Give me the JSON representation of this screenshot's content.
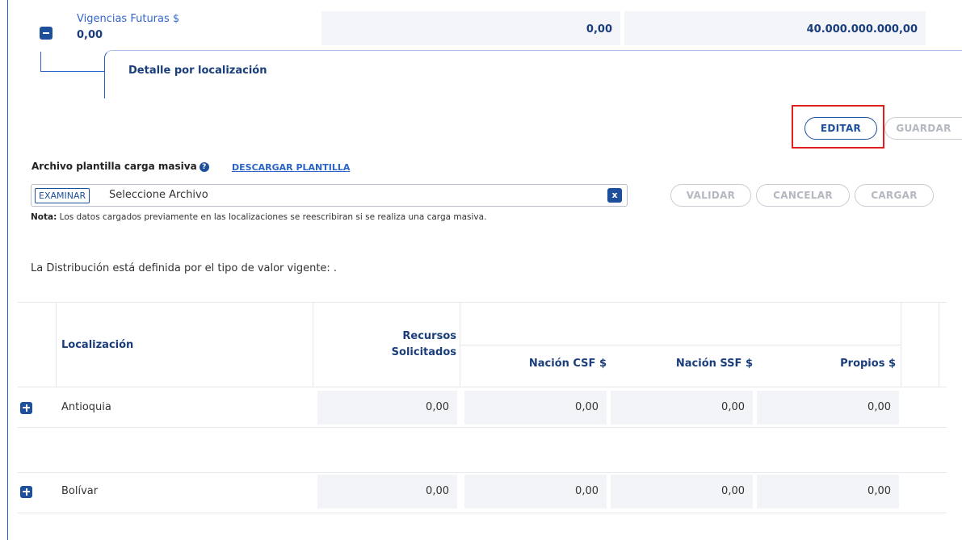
{
  "vigencias": {
    "label": "Vigencias Futuras $",
    "value": "0,00",
    "col1": "0,00",
    "col2": "40.000.000.000,00"
  },
  "detalle": {
    "title": "Detalle por localización"
  },
  "actions": {
    "editar": "EDITAR",
    "guardar": "GUARDAR"
  },
  "upload": {
    "label": "Archivo plantilla carga masiva",
    "help_icon": "?",
    "download_link": "DESCARGAR PLANTILLA",
    "examinar": "EXAMINAR",
    "placeholder": "Seleccione Archivo",
    "clear": "x",
    "validar": "VALIDAR",
    "cancelar": "CANCELAR",
    "cargar": "CARGAR",
    "nota_label": "Nota:",
    "nota_text": "Los datos cargados previamente en las localizaciones se reescribiran si se realiza una carga masiva."
  },
  "distribucion_text": "La Distribución está definida por el tipo de valor vigente: .",
  "table": {
    "headers": {
      "localizacion": "Localización",
      "recursos_1": "Recursos",
      "recursos_2": "Solicitados",
      "nacion_csf": "Nación CSF $",
      "nacion_ssf": "Nación SSF $",
      "propios": "Propios $"
    },
    "rows": [
      {
        "name": "Antioquia",
        "recursos": "0,00",
        "nacion_csf": "0,00",
        "nacion_ssf": "0,00",
        "propios": "0,00"
      },
      {
        "name": "Bolívar",
        "recursos": "0,00",
        "nacion_csf": "0,00",
        "nacion_ssf": "0,00",
        "propios": "0,00"
      }
    ]
  }
}
